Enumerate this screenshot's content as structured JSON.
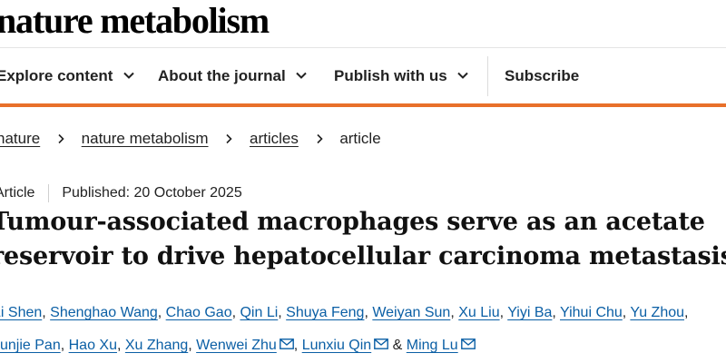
{
  "logo": "nature metabolism",
  "nav": {
    "items": [
      {
        "label": "Explore content"
      },
      {
        "label": "About the journal"
      },
      {
        "label": "Publish with us"
      }
    ],
    "subscribe": "Subscribe"
  },
  "breadcrumb": {
    "items": [
      "nature",
      "nature metabolism",
      "articles"
    ],
    "current": "article"
  },
  "meta": {
    "type": "Article",
    "published": "Published: 20 October 2025"
  },
  "title": {
    "line1": "Tumour-associated macrophages serve as an acetate",
    "line2": "reservoir to drive hepatocellular carcinoma metastasis"
  },
  "authors": [
    "Li Shen",
    "Shenghao Wang",
    "Chao Gao",
    "Qin Li",
    "Shuya Feng",
    "Weiyan Sun",
    "Xu Liu",
    "Yiyi Ba",
    "Yihui Chu",
    "Yu Zhou",
    "Junjie Pan",
    "Hao Xu",
    "Xu Zhang",
    "Wenwei Zhu",
    "Lunxiu Qin",
    "Ming Lu"
  ],
  "authors_connector": "&",
  "colors": {
    "accent": "#e8702a",
    "link": "#0b5fa5"
  }
}
